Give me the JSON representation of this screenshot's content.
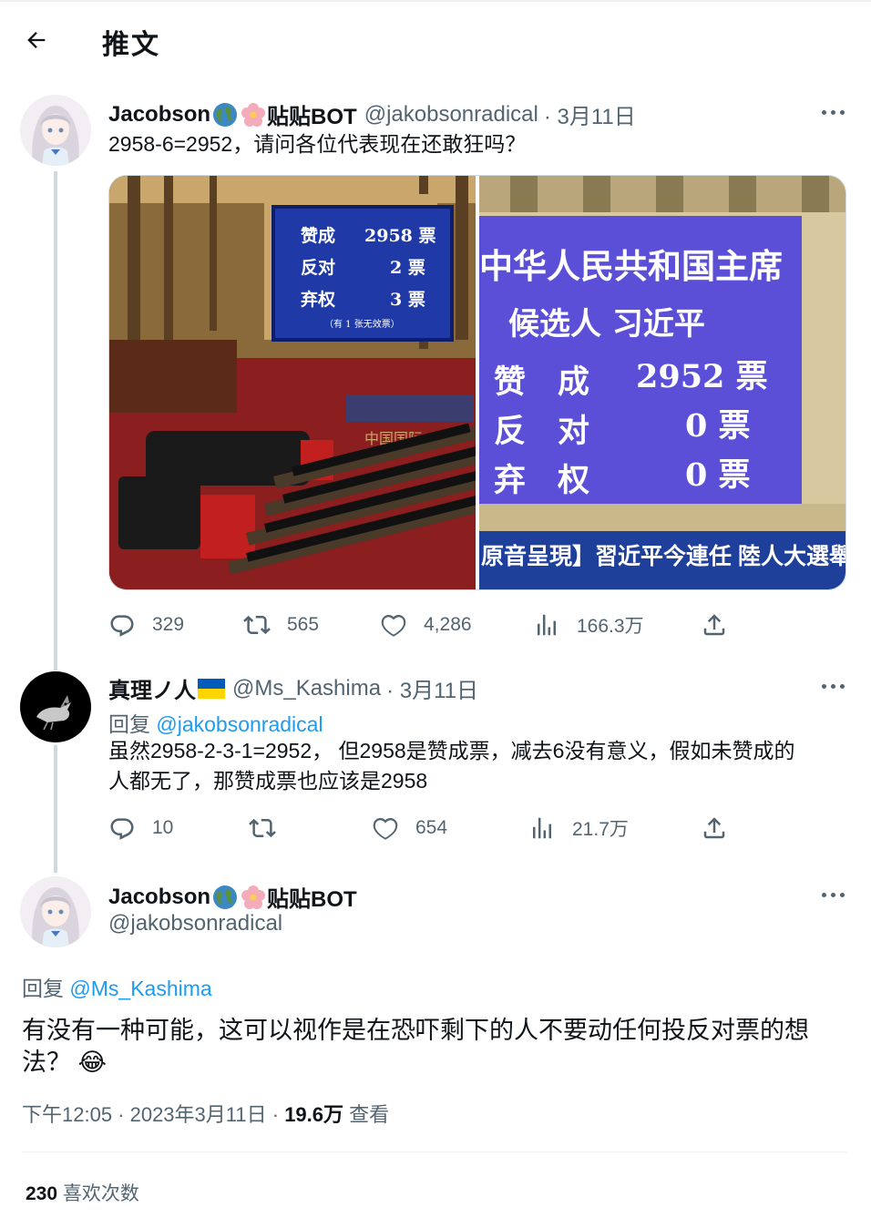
{
  "header": {
    "title": "推文"
  },
  "tweet1": {
    "display_name": "Jacobson",
    "bot_label": "贴贴BOT",
    "handle": "@jakobsonradical",
    "date": "· 3月11日",
    "text": "2958-6=2952，请问各位代表现在还敢狂吗？",
    "media_left": {
      "rows": [
        {
          "label": "赞成",
          "value": "2958 票"
        },
        {
          "label": "反对",
          "value": "2 票"
        },
        {
          "label": "弃权",
          "value": "3 票"
        }
      ],
      "note": "（有 1 张无效票）",
      "banner": "中国国际"
    },
    "media_right": {
      "title": "中华人民共和国主席",
      "candidate": "候选人  习近平",
      "rows": [
        {
          "label": "赞　成",
          "value": "2952 票"
        },
        {
          "label": "反　对",
          "value": "0 票"
        },
        {
          "label": "弃　权",
          "value": "0 票"
        }
      ],
      "caption": "原音呈現】習近平今連任 陸人大選舉國家"
    },
    "stats": {
      "replies": "329",
      "retweets": "565",
      "likes": "4,286",
      "views": "166.3万"
    }
  },
  "tweet2": {
    "display_name": "真理ノ人",
    "handle": "@Ms_Kashima",
    "date": "· 3月11日",
    "reply_prefix": "回复",
    "reply_mention": "@jakobsonradical",
    "text_line1": "虽然2958-2-3-1=2952， 但2958是赞成票，减去6没有意义，假如未赞成的",
    "text_line2": "人都无了，那赞成票也应该是2958",
    "stats": {
      "replies": "10",
      "retweets": "",
      "likes": "654",
      "views": "21.7万"
    }
  },
  "tweet3": {
    "display_name": "Jacobson",
    "bot_label": "贴贴BOT",
    "handle": "@jakobsonradical",
    "reply_prefix": "回复",
    "reply_mention": "@Ms_Kashima",
    "text_line1": "有没有一种可能，这可以视作是在恐吓剩下的人不要动任何投反对票的想",
    "text_line2": "法？",
    "emoji": "😂",
    "time": "下午12:05 · 2023年3月11日 ·",
    "views_count": "19.6万",
    "views_label": "查看",
    "likes_count": "230",
    "likes_label": "喜欢次数"
  },
  "colors": {
    "accent": "#1d9bf0",
    "muted": "#536471",
    "text": "#0f1419",
    "line": "#cfd9de"
  },
  "icons": [
    "back-arrow-icon",
    "globe-icon",
    "flower-icon",
    "more-icon",
    "reply-icon",
    "retweet-icon",
    "like-icon",
    "views-icon",
    "share-icon",
    "ukraine-flag-icon"
  ]
}
